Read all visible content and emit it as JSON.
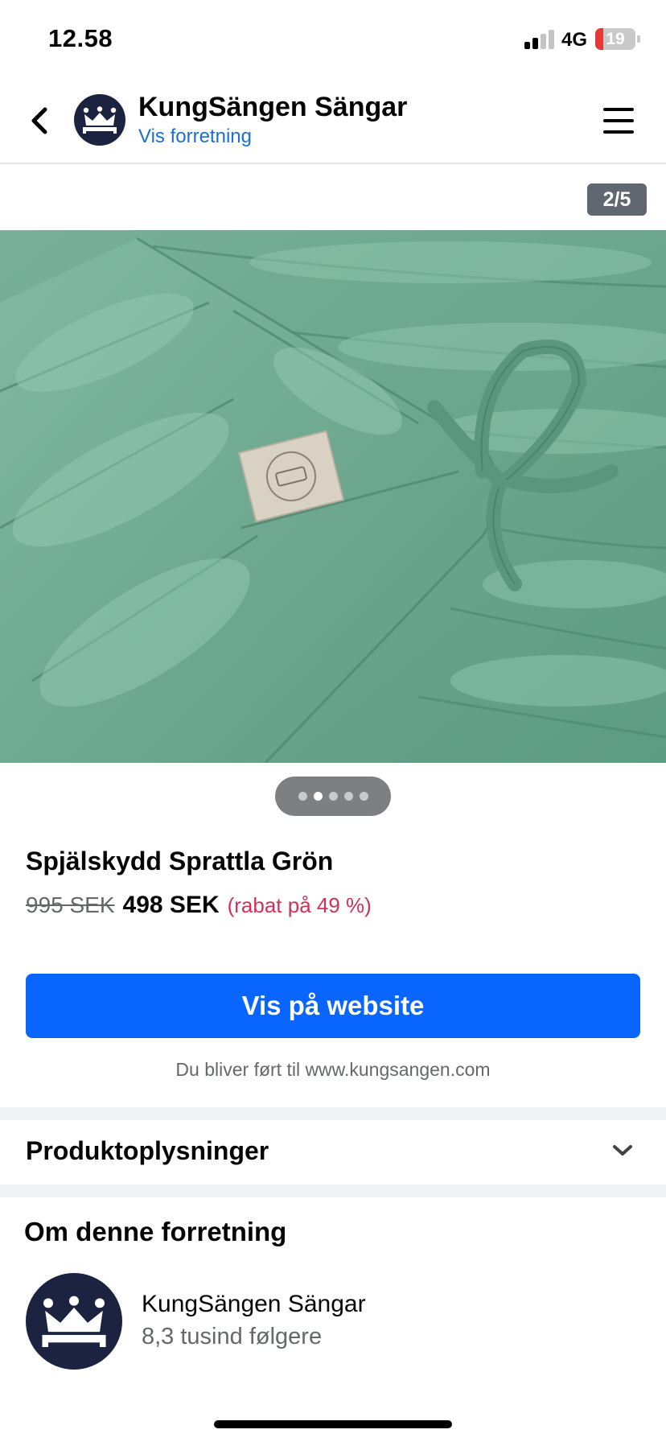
{
  "status_bar": {
    "time": "12.58",
    "network": "4G",
    "battery": "19",
    "battery_level_percent": 19,
    "battery_color": "#e53935"
  },
  "header": {
    "back_icon": "chevron-left-icon",
    "page_name": "KungSängen Sängar",
    "page_link": "Vis forretning",
    "menu_icon": "hamburger-menu-icon",
    "avatar_icon": "crown-bed-logo"
  },
  "gallery": {
    "counter": "2/5",
    "current_index": 2,
    "total": 5,
    "image_description_icon": "product-photo-green-quilted-bumper"
  },
  "product": {
    "title": "Spjälskydd Sprattla Grön",
    "old_price": "995 SEK",
    "new_price": "498 SEK",
    "discount": "(rabat på 49 %)",
    "discount_color": "#d0315a"
  },
  "cta": {
    "label": "Vis på website",
    "note": "Du bliver ført til www.kungsangen.com",
    "color": "#0866ff"
  },
  "sections": {
    "product_info": "Produktoplysninger",
    "product_info_icon": "chevron-down-icon"
  },
  "about": {
    "title": "Om denne forretning",
    "name": "KungSängen Sängar",
    "followers": "8,3 tusind følgere"
  }
}
